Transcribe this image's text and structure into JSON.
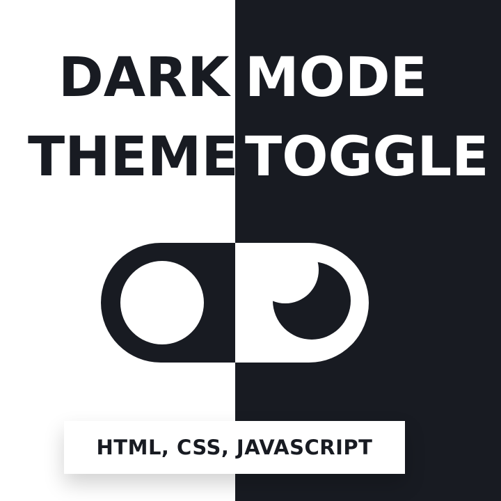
{
  "colors": {
    "light": "#ffffff",
    "dark": "#181b22"
  },
  "title": {
    "word1": "DARK",
    "word2": "MODE",
    "word3": "THEME",
    "word4": "TOGGLE"
  },
  "toggle": {
    "left_knob_icon": "circle-icon",
    "right_knob_icon": "crescent-moon-icon"
  },
  "badge": {
    "text": "HTML, CSS, JAVASCRIPT"
  }
}
